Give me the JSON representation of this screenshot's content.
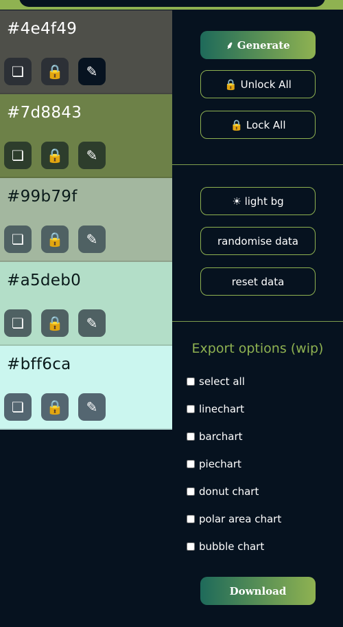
{
  "swatches": [
    {
      "hex": "#4e4f49",
      "bg": "#4e4f49",
      "text_color": "#ffffff",
      "btn_bg": "#2c3036",
      "btn_active_bg": "#071320",
      "active_edit": true
    },
    {
      "hex": "#7d8843",
      "bg": "#6d8148",
      "text_color": "#ffffff",
      "btn_bg": "#2d3d2c",
      "btn_active_bg": "#2d3d2c",
      "active_edit": false
    },
    {
      "hex": "#99b79f",
      "bg": "#a3b79f",
      "text_color": "#0a1a1a",
      "btn_bg": "#4f6163",
      "btn_active_bg": "#4f6163",
      "active_edit": false
    },
    {
      "hex": "#a5deb0",
      "bg": "#b3dec8",
      "text_color": "#0a1a1a",
      "btn_bg": "#4f6163",
      "btn_active_bg": "#4f6163",
      "active_edit": false
    },
    {
      "hex": "#bff6ca",
      "bg": "#cbf6ef",
      "text_color": "#0a1a1a",
      "btn_bg": "#546671",
      "btn_active_bg": "#546671",
      "active_edit": false
    }
  ],
  "icons": {
    "copy": "❏",
    "lock": "🔒",
    "edit": "✎"
  },
  "sidebar": {
    "generate_label": "⸙ Generate",
    "unlock_label": "🔒 Unlock All",
    "lock_label": "🔒 Lock All",
    "light_bg_label": "☀ light bg",
    "randomise_label": "randomise data",
    "reset_label": "reset data",
    "export_title": "Export options (wip)",
    "options": [
      "select all",
      "linechart",
      "barchart",
      "piechart",
      "donut chart",
      "polar area chart",
      "bubble chart"
    ],
    "download_label": "Download"
  },
  "colors": {
    "background": "#06121f",
    "accent": "#8fb251"
  }
}
